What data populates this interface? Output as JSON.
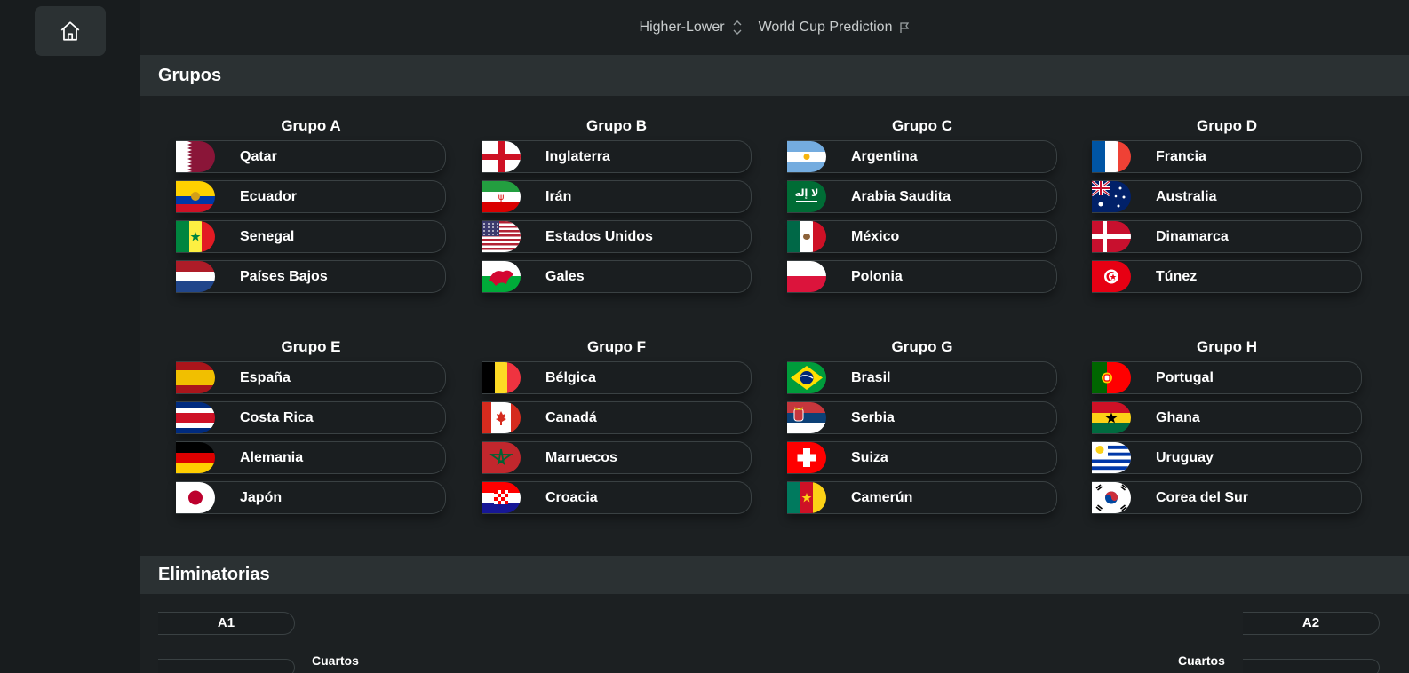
{
  "nav": {
    "items": [
      {
        "label": "Higher-Lower",
        "icon": "chevron-up-down-icon"
      },
      {
        "label": "World Cup Prediction",
        "icon": "flag-icon"
      }
    ]
  },
  "sections": {
    "groups_title": "Grupos",
    "knockout_title": "Eliminatorias"
  },
  "groups": [
    {
      "title": "Grupo A",
      "teams": [
        {
          "name": "Qatar",
          "flag": "qatar"
        },
        {
          "name": "Ecuador",
          "flag": "ecuador"
        },
        {
          "name": "Senegal",
          "flag": "senegal"
        },
        {
          "name": "Países Bajos",
          "flag": "netherlands"
        }
      ]
    },
    {
      "title": "Grupo B",
      "teams": [
        {
          "name": "Inglaterra",
          "flag": "england"
        },
        {
          "name": "Irán",
          "flag": "iran"
        },
        {
          "name": "Estados Unidos",
          "flag": "usa"
        },
        {
          "name": "Gales",
          "flag": "wales"
        }
      ]
    },
    {
      "title": "Grupo C",
      "teams": [
        {
          "name": "Argentina",
          "flag": "argentina"
        },
        {
          "name": "Arabia Saudita",
          "flag": "saudi"
        },
        {
          "name": "México",
          "flag": "mexico"
        },
        {
          "name": "Polonia",
          "flag": "poland"
        }
      ]
    },
    {
      "title": "Grupo D",
      "teams": [
        {
          "name": "Francia",
          "flag": "france"
        },
        {
          "name": "Australia",
          "flag": "australia"
        },
        {
          "name": "Dinamarca",
          "flag": "denmark"
        },
        {
          "name": "Túnez",
          "flag": "tunisia"
        }
      ]
    },
    {
      "title": "Grupo E",
      "teams": [
        {
          "name": "España",
          "flag": "spain"
        },
        {
          "name": "Costa Rica",
          "flag": "costarica"
        },
        {
          "name": "Alemania",
          "flag": "germany"
        },
        {
          "name": "Japón",
          "flag": "japan"
        }
      ]
    },
    {
      "title": "Grupo F",
      "teams": [
        {
          "name": "Bélgica",
          "flag": "belgium"
        },
        {
          "name": "Canadá",
          "flag": "canada"
        },
        {
          "name": "Marruecos",
          "flag": "morocco"
        },
        {
          "name": "Croacia",
          "flag": "croatia"
        }
      ]
    },
    {
      "title": "Grupo G",
      "teams": [
        {
          "name": "Brasil",
          "flag": "brazil"
        },
        {
          "name": "Serbia",
          "flag": "serbia"
        },
        {
          "name": "Suiza",
          "flag": "switzerland"
        },
        {
          "name": "Camerún",
          "flag": "cameroon"
        }
      ]
    },
    {
      "title": "Grupo H",
      "teams": [
        {
          "name": "Portugal",
          "flag": "portugal"
        },
        {
          "name": "Ghana",
          "flag": "ghana"
        },
        {
          "name": "Uruguay",
          "flag": "uruguay"
        },
        {
          "name": "Corea del Sur",
          "flag": "korea"
        }
      ]
    }
  ],
  "bracket": {
    "left_slot": "A1",
    "right_slot": "A2",
    "left_round": "Cuartos",
    "right_round": "Cuartos"
  }
}
